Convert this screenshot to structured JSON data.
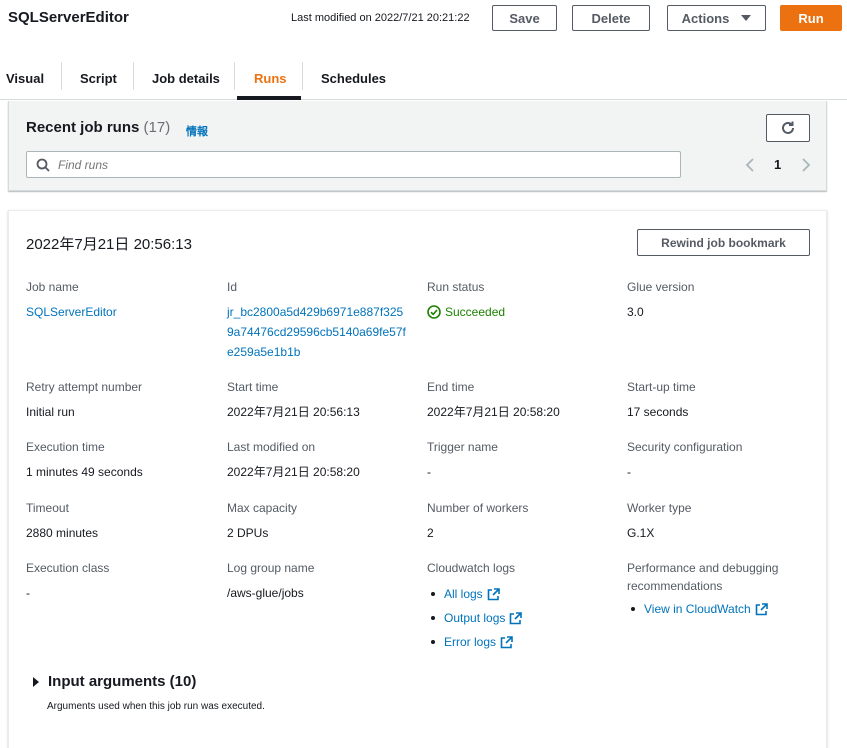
{
  "header": {
    "title": "SQLServerEditor",
    "last_modified": "Last modified on 2022/7/21 20:21:22",
    "save_label": "Save",
    "delete_label": "Delete",
    "actions_label": "Actions",
    "run_label": "Run"
  },
  "tabs": [
    {
      "label": "Visual"
    },
    {
      "label": "Script"
    },
    {
      "label": "Job details"
    },
    {
      "label": "Runs",
      "active": true
    },
    {
      "label": "Schedules"
    }
  ],
  "recent_runs": {
    "title": "Recent job runs",
    "count": "(17)",
    "info": "情報",
    "search_placeholder": "Find runs",
    "page": "1"
  },
  "run": {
    "date": "2022年7月21日 20:56:13",
    "rewind_label": "Rewind job bookmark",
    "fields": {
      "job_name": {
        "label": "Job name",
        "value": "SQLServerEditor"
      },
      "id": {
        "label": "Id",
        "value": "jr_bc2800a5d429b6971e887f3259a74476cd29596cb5140a69fe57fe259a5e1b1b"
      },
      "run_status": {
        "label": "Run status",
        "value": "Succeeded"
      },
      "glue_version": {
        "label": "Glue version",
        "value": "3.0"
      },
      "retry_attempt": {
        "label": "Retry attempt number",
        "value": "Initial run"
      },
      "start_time": {
        "label": "Start time",
        "value": "2022年7月21日 20:56:13"
      },
      "end_time": {
        "label": "End time",
        "value": "2022年7月21日 20:58:20"
      },
      "startup_time": {
        "label": "Start-up time",
        "value": "17 seconds"
      },
      "execution_time": {
        "label": "Execution time",
        "value": "1 minutes 49 seconds"
      },
      "last_modified_on": {
        "label": "Last modified on",
        "value": "2022年7月21日 20:58:20"
      },
      "trigger_name": {
        "label": "Trigger name",
        "value": "-"
      },
      "security_config": {
        "label": "Security configuration",
        "value": "-"
      },
      "timeout": {
        "label": "Timeout",
        "value": "2880 minutes"
      },
      "max_capacity": {
        "label": "Max capacity",
        "value": "2 DPUs"
      },
      "num_workers": {
        "label": "Number of workers",
        "value": "2"
      },
      "worker_type": {
        "label": "Worker type",
        "value": "G.1X"
      },
      "execution_class": {
        "label": "Execution class",
        "value": "-"
      },
      "log_group": {
        "label": "Log group name",
        "value": "/aws-glue/jobs"
      },
      "cloudwatch_logs": {
        "label": "Cloudwatch logs",
        "links": [
          "All logs",
          "Output logs",
          "Error logs"
        ]
      },
      "perf_debug": {
        "label": "Performance and debugging recommendations",
        "links": [
          "View in CloudWatch"
        ]
      }
    },
    "input_arguments": {
      "title": "Input arguments (10)",
      "description": "Arguments used when this job run was executed."
    }
  },
  "colors": {
    "accent": "#ec7211",
    "link": "#0073bb",
    "success": "#1d8102"
  }
}
